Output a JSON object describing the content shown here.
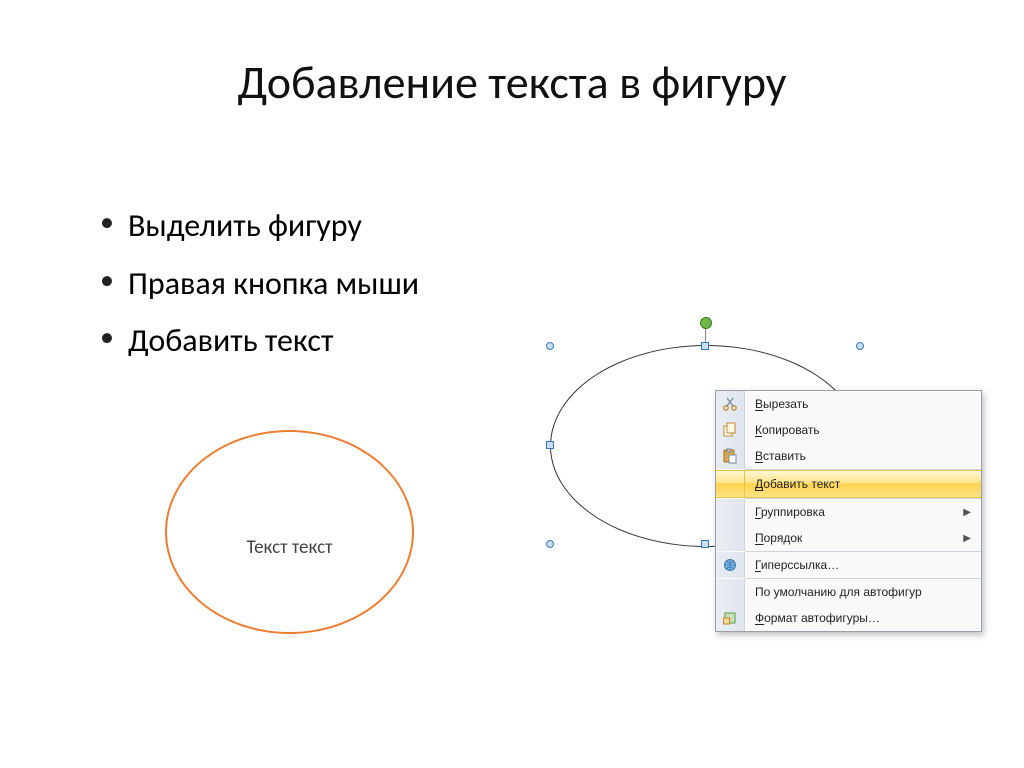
{
  "title": "Добавление текста в фигуру",
  "bullets": [
    "Выделить фигуру",
    "Правая кнопка мыши",
    "Добавить текст"
  ],
  "orange_shape": {
    "text": "Текст текст"
  },
  "context_menu": {
    "items": [
      {
        "label": "Вырезать",
        "underline_first": true,
        "icon": "cut",
        "submenu": false,
        "highlighted": false
      },
      {
        "label": "Копировать",
        "underline_first": true,
        "icon": "copy",
        "submenu": false,
        "highlighted": false
      },
      {
        "label": "Вставить",
        "underline_first": true,
        "icon": "paste",
        "submenu": false,
        "highlighted": false
      },
      {
        "sep": true
      },
      {
        "label": "Добавить текст",
        "underline_first": true,
        "icon": "",
        "submenu": false,
        "highlighted": true
      },
      {
        "sep": true
      },
      {
        "label": "Группировка",
        "underline_first": true,
        "icon": "",
        "submenu": true,
        "highlighted": false
      },
      {
        "label": "Порядок",
        "underline_first": true,
        "icon": "",
        "submenu": true,
        "highlighted": false
      },
      {
        "sep": true
      },
      {
        "label": "Гиперссылка…",
        "underline_first": true,
        "icon": "hyperlink",
        "submenu": false,
        "highlighted": false
      },
      {
        "sep": true
      },
      {
        "label": "По умолчанию для автофигур",
        "underline_first": false,
        "icon": "",
        "submenu": false,
        "highlighted": false
      },
      {
        "label": "Формат автофигуры…",
        "underline_first": true,
        "icon": "format",
        "submenu": false,
        "highlighted": false
      }
    ]
  }
}
